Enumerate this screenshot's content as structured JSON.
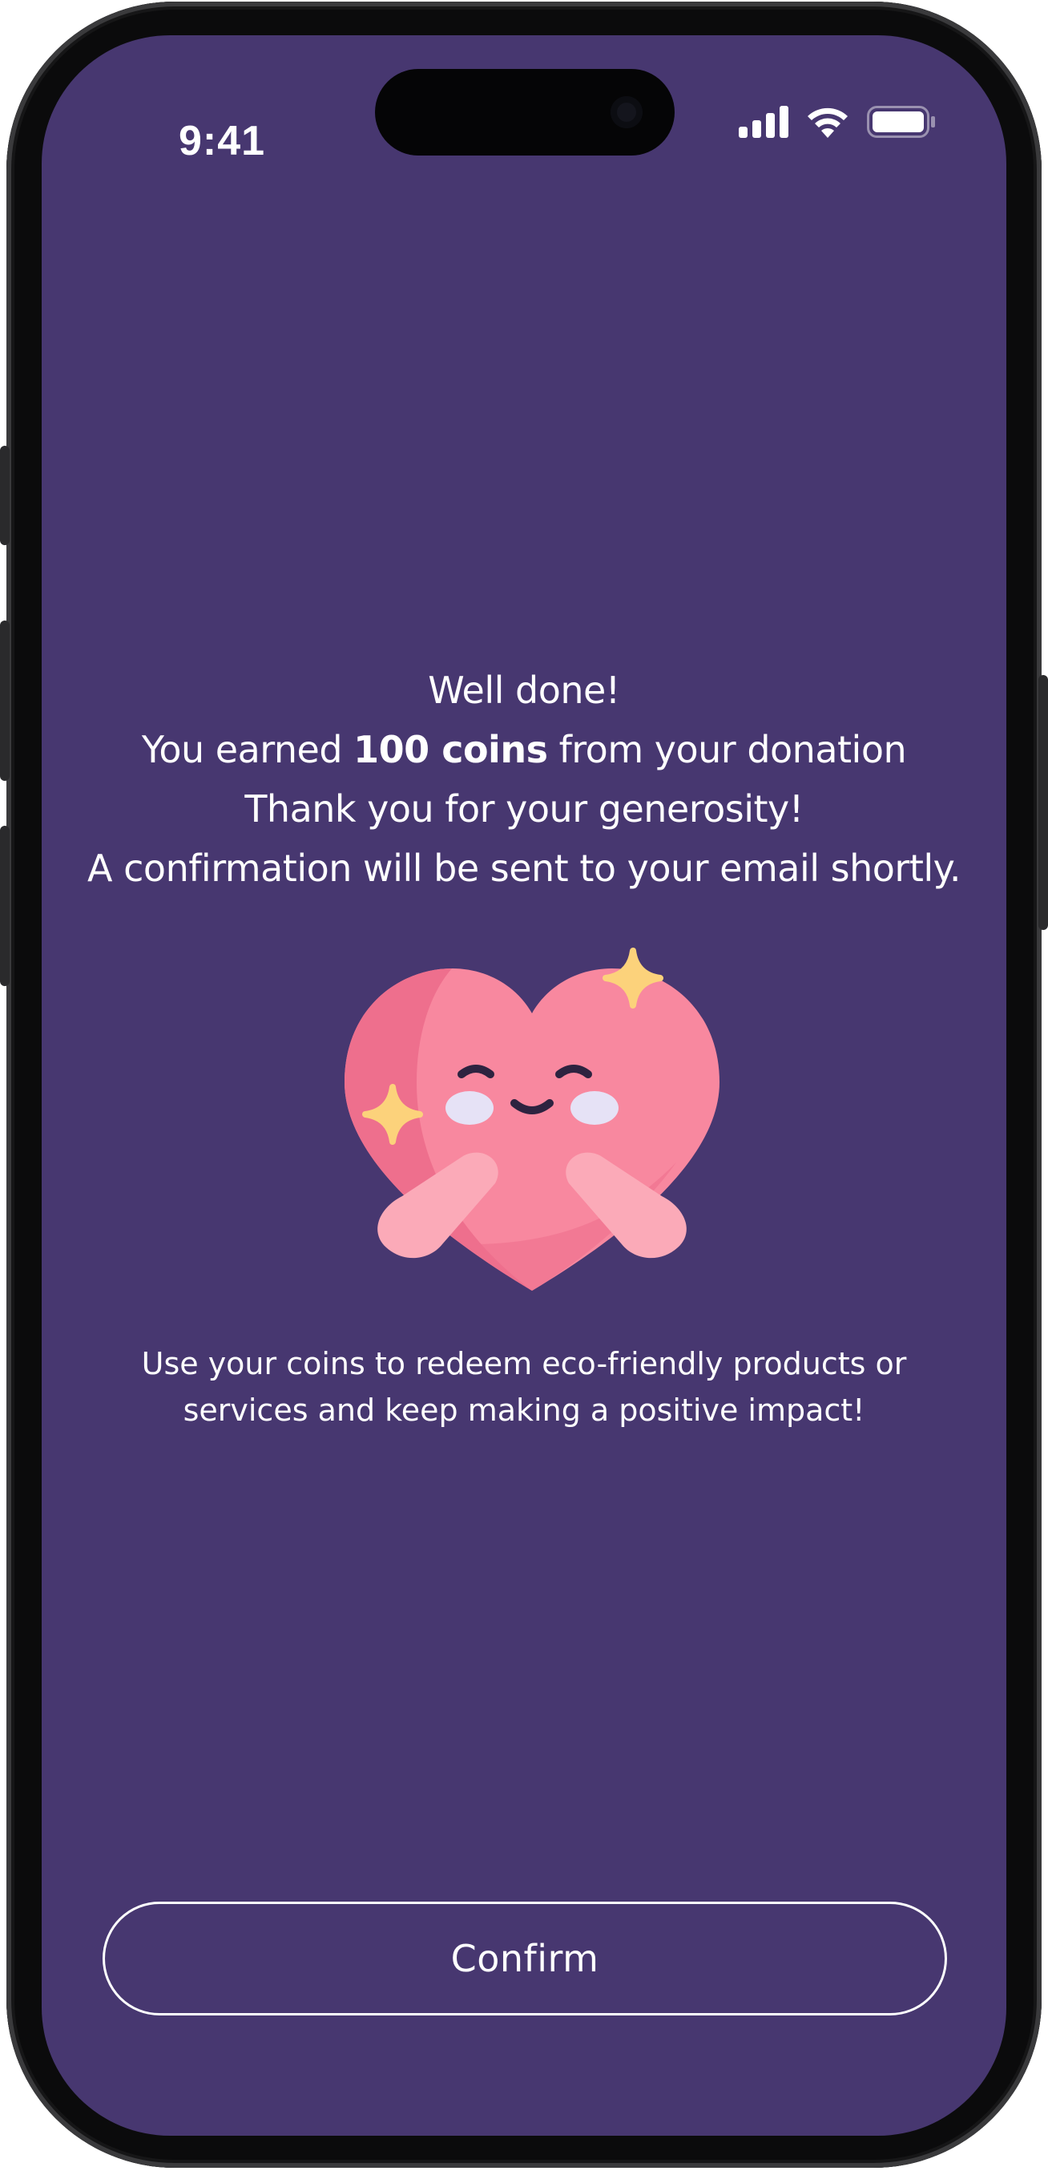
{
  "status_bar": {
    "time": "9:41",
    "signal_icon": "cellular-signal-icon",
    "wifi_icon": "wifi-icon",
    "battery_icon": "battery-icon"
  },
  "message": {
    "line1": "Well done!",
    "line2_prefix": "You earned ",
    "line2_bold": "100 coins",
    "line2_suffix": " from your donation",
    "line3": "Thank you for your generosity!",
    "line4": "A confirmation will be sent to your email shortly."
  },
  "illustration": {
    "icon": "hugging-heart-icon"
  },
  "subtext": {
    "line1": "Use your coins to redeem eco-friendly products or",
    "line2": "services and keep making a positive impact!"
  },
  "confirm_button": {
    "label": "Confirm"
  },
  "colors": {
    "background": "#473770",
    "text": "#ffffff",
    "heart": "#f8889f",
    "heart_shade": "#ee6f8d",
    "sparkle": "#fcd27b"
  }
}
